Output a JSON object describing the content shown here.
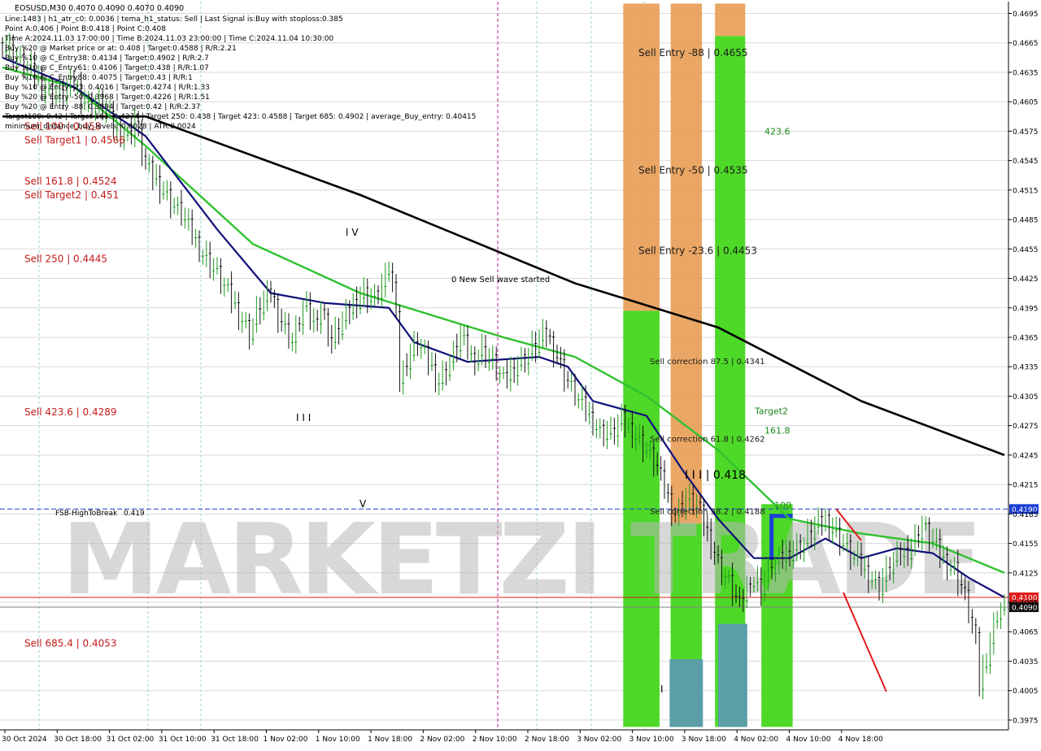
{
  "header": {
    "symbol_line": "EOSUSD,M30  0.4070 0.4090 0.4070 0.4090",
    "info_lines": [
      "Line:1483 | h1_atr_c0: 0.0036 | tema_h1_status: Sell | Last Signal is:Buy with stoploss:0.385",
      "Point A:0.406 | Point B:0.418 | Point C:0.408",
      "Time A:2024.11.03 17:00:00 | Time B:2024.11.03 23:00:00 | Time C:2024.11.04 10:30:00",
      "Buy %20 @ Market price or at: 0.408 | Target:0.4588 | R/R:2.21",
      "Buy %10 @ C_Entry38: 0.4134 | Target:0.4902 | R/R:2.7",
      "Buy %10 @ C_Entry61: 0.4106 | Target:0.438 | R/R:1.07",
      "Buy %10 @ C_Entry88: 0.4075 | Target:0.43 | R/R:1",
      "Buy %10 @ Entry -23: 0.4016 | Target:0.4274 | R/R:1.33",
      "Buy %20 @ Entry -50: 0.3968 | Target:0.4226 | R/R:1.51",
      "Buy %20 @ Entry -88: 0.3894 | Target:0.42 | R/R:2.37",
      "Target100: 0.42 | Target 161: 0.4274 | Target 250: 0.438 | Target 423: 0.4588 | Target 685: 0.4902 | average_Buy_entry: 0.40415",
      "minimum_distance_buy_levels: 0.0028 | ATR:0.0024"
    ]
  },
  "left_labels": [
    {
      "text": "Sell 100 | 0.458",
      "price": 0.458
    },
    {
      "text": "Sell Target1 | 0.4566",
      "price": 0.4566
    },
    {
      "text": "Sell 161.8 | 0.4524",
      "price": 0.4524
    },
    {
      "text": "Sell Target2 | 0.451",
      "price": 0.451
    },
    {
      "text": "Sell  250 | 0.4445",
      "price": 0.4445
    },
    {
      "text": "Sell  423.6 | 0.4289",
      "price": 0.4289
    },
    {
      "text": "Sell  685.4 | 0.4053",
      "price": 0.4053
    }
  ],
  "zone_labels": [
    {
      "text": "Sell Entry -88 | 0.4655",
      "price": 0.4655
    },
    {
      "text": "Sell Entry -50 | 0.4535",
      "price": 0.4535
    },
    {
      "text": "Sell Entry -23.6 | 0.4453",
      "price": 0.4453
    },
    {
      "text": "Sell correction 87.5 | 0.4341",
      "price": 0.4341
    },
    {
      "text": "Sell correction 61.8 | 0.4262",
      "price": 0.4262
    },
    {
      "text": "Sell correction 38.2 | 0.4188",
      "price": 0.4188
    }
  ],
  "green_labels": [
    {
      "text": "423.6",
      "price": 0.4575
    },
    {
      "text": "Target2",
      "price": 0.429
    },
    {
      "text": "161.8",
      "price": 0.427
    },
    {
      "text": "100",
      "price": 0.4194
    }
  ],
  "annotations": {
    "wave_text": "0 New Sell wave started",
    "wave_roman_iv": "I V",
    "wave_roman_iii": "I I I",
    "wave_roman_v": "V",
    "wave_roman_i": "I",
    "point_label": "I I I | 0.418",
    "fsb_label": "FSB-HighToBreak",
    "fsb_value": "0.419",
    "watermark": "MARKETZI TRADE"
  },
  "price_tags": [
    {
      "text": "0.4190",
      "price": 0.419,
      "color": "#1a3fd6"
    },
    {
      "text": "0.4100",
      "price": 0.41,
      "color": "#e01b1b"
    },
    {
      "text": "0.4090",
      "price": 0.409,
      "color": "#111111"
    }
  ],
  "colors": {
    "background": "#ffffff",
    "grid": "#d8d8d8",
    "sell_orange": "#e9a15c",
    "bright_green": "#45d61c",
    "teal": "#5c9ea8",
    "black_ma": "#000000",
    "green_ma": "#2fc22f",
    "navy_ma": "#10107a",
    "red_line": "#e01b1b",
    "blue_line": "#1a3fd6"
  },
  "chart_data": {
    "type": "candlestick",
    "symbol": "EOSUSD",
    "timeframe": "M30",
    "ylim": [
      0.3965,
      0.4707
    ],
    "y_ticks": [
      "0.4695",
      "0.4665",
      "0.4635",
      "0.4605",
      "0.4575",
      "0.4545",
      "0.4515",
      "0.4485",
      "0.4455",
      "0.4425",
      "0.4395",
      "0.4365",
      "0.4335",
      "0.4305",
      "0.4275",
      "0.4245",
      "0.4215",
      "0.4185",
      "0.4155",
      "0.4125",
      "0.4095",
      "0.4065",
      "0.4035",
      "0.4005",
      "0.3975"
    ],
    "x_ticks": [
      "30 Oct 2024",
      "30 Oct 18:00",
      "31 Oct 02:00",
      "31 Oct 10:00",
      "31 Oct 18:00",
      "1 Nov 02:00",
      "1 Nov 10:00",
      "1 Nov 18:00",
      "2 Nov 02:00",
      "2 Nov 10:00",
      "2 Nov 18:00",
      "3 Nov 02:00",
      "3 Nov 10:00",
      "3 Nov 18:00",
      "4 Nov 02:00",
      "4 Nov 10:00",
      "4 Nov 18:00"
    ],
    "close_path": [
      [
        0,
        0.4665
      ],
      [
        4,
        0.465
      ],
      [
        8,
        0.4635
      ],
      [
        12,
        0.462
      ],
      [
        16,
        0.461
      ],
      [
        20,
        0.4625
      ],
      [
        24,
        0.46
      ],
      [
        27,
        0.4605
      ],
      [
        31,
        0.458
      ],
      [
        35,
        0.457
      ],
      [
        37,
        0.4585
      ],
      [
        40,
        0.454
      ],
      [
        44,
        0.452
      ],
      [
        47,
        0.4505
      ],
      [
        50,
        0.449
      ],
      [
        53,
        0.447
      ],
      [
        56,
        0.445
      ],
      [
        60,
        0.443
      ],
      [
        63,
        0.441
      ],
      [
        66,
        0.439
      ],
      [
        69,
        0.437
      ],
      [
        72,
        0.4395
      ],
      [
        75,
        0.441
      ],
      [
        78,
        0.438
      ],
      [
        81,
        0.436
      ],
      [
        84,
        0.4395
      ],
      [
        87,
        0.438
      ],
      [
        89,
        0.4395
      ],
      [
        92,
        0.436
      ],
      [
        95,
        0.438
      ],
      [
        98,
        0.44
      ],
      [
        101,
        0.441
      ],
      [
        104,
        0.4405
      ],
      [
        107,
        0.442
      ],
      [
        108,
        0.4435
      ],
      [
        110,
        0.44
      ],
      [
        111,
        0.432
      ],
      [
        113,
        0.434
      ],
      [
        116,
        0.436
      ],
      [
        119,
        0.434
      ],
      [
        122,
        0.432
      ],
      [
        125,
        0.434
      ],
      [
        128,
        0.4365
      ],
      [
        131,
        0.4345
      ],
      [
        134,
        0.435
      ],
      [
        137,
        0.434
      ],
      [
        140,
        0.432
      ],
      [
        143,
        0.4335
      ],
      [
        146,
        0.4345
      ],
      [
        149,
        0.4355
      ],
      [
        152,
        0.437
      ],
      [
        155,
        0.4345
      ],
      [
        158,
        0.432
      ],
      [
        161,
        0.43
      ],
      [
        164,
        0.4285
      ],
      [
        167,
        0.427
      ],
      [
        170,
        0.4265
      ],
      [
        173,
        0.428
      ],
      [
        176,
        0.427
      ],
      [
        179,
        0.4255
      ],
      [
        182,
        0.424
      ],
      [
        185,
        0.421
      ],
      [
        188,
        0.4185
      ],
      [
        191,
        0.42
      ],
      [
        194,
        0.4195
      ],
      [
        197,
        0.4165
      ],
      [
        200,
        0.4135
      ],
      [
        203,
        0.4115
      ],
      [
        206,
        0.409
      ],
      [
        209,
        0.412
      ],
      [
        212,
        0.411
      ],
      [
        215,
        0.413
      ],
      [
        218,
        0.414
      ],
      [
        221,
        0.415
      ],
      [
        224,
        0.4155
      ],
      [
        227,
        0.417
      ],
      [
        230,
        0.418
      ],
      [
        233,
        0.4165
      ],
      [
        236,
        0.415
      ],
      [
        239,
        0.4135
      ],
      [
        242,
        0.4125
      ],
      [
        245,
        0.411
      ],
      [
        248,
        0.413
      ],
      [
        251,
        0.4145
      ],
      [
        254,
        0.415
      ],
      [
        257,
        0.4175
      ],
      [
        260,
        0.4155
      ],
      [
        263,
        0.414
      ],
      [
        266,
        0.413
      ],
      [
        269,
        0.41
      ],
      [
        272,
        0.4055
      ],
      [
        273,
        0.401
      ],
      [
        275,
        0.404
      ],
      [
        278,
        0.4085
      ],
      [
        280,
        0.409
      ]
    ],
    "series": [
      {
        "kind": "moving_average_black",
        "values": [
          [
            0,
            0.459
          ],
          [
            40,
            0.459
          ],
          [
            100,
            0.451
          ],
          [
            160,
            0.442
          ],
          [
            200,
            0.4375
          ],
          [
            240,
            0.43
          ],
          [
            280,
            0.4245
          ]
        ]
      },
      {
        "kind": "moving_average_green",
        "values": [
          [
            0,
            0.464
          ],
          [
            20,
            0.462
          ],
          [
            40,
            0.456
          ],
          [
            70,
            0.446
          ],
          [
            100,
            0.441
          ],
          [
            140,
            0.4365
          ],
          [
            160,
            0.4345
          ],
          [
            180,
            0.4305
          ],
          [
            200,
            0.425
          ],
          [
            220,
            0.418
          ],
          [
            240,
            0.4165
          ],
          [
            260,
            0.4155
          ],
          [
            280,
            0.4125
          ]
        ]
      },
      {
        "kind": "moving_average_navy",
        "values": [
          [
            0,
            0.465
          ],
          [
            20,
            0.462
          ],
          [
            40,
            0.457
          ],
          [
            60,
            0.4475
          ],
          [
            75,
            0.441
          ],
          [
            90,
            0.44
          ],
          [
            108,
            0.4395
          ],
          [
            115,
            0.436
          ],
          [
            130,
            0.434
          ],
          [
            150,
            0.4345
          ],
          [
            158,
            0.4335
          ],
          [
            165,
            0.43
          ],
          [
            180,
            0.4285
          ],
          [
            190,
            0.423
          ],
          [
            200,
            0.418
          ],
          [
            210,
            0.414
          ],
          [
            220,
            0.414
          ],
          [
            230,
            0.416
          ],
          [
            240,
            0.414
          ],
          [
            250,
            0.415
          ],
          [
            260,
            0.4145
          ],
          [
            270,
            0.412
          ],
          [
            280,
            0.41
          ]
        ]
      }
    ],
    "zones": [
      {
        "kind": "orange",
        "x_from": 0.618,
        "x_to": 0.654,
        "y_from": 0.4705,
        "y_to": 0.4392
      },
      {
        "kind": "green",
        "x_from": 0.618,
        "x_to": 0.654,
        "y_from": 0.4392,
        "y_to": 0.3968
      },
      {
        "kind": "orange",
        "x_from": 0.665,
        "x_to": 0.696,
        "y_from": 0.4705,
        "y_to": 0.4175
      },
      {
        "kind": "green",
        "x_from": 0.665,
        "x_to": 0.696,
        "y_from": 0.4175,
        "y_to": 0.3968
      },
      {
        "kind": "orange",
        "x_from": 0.709,
        "x_to": 0.739,
        "y_from": 0.4705,
        "y_to": 0.4672
      },
      {
        "kind": "green",
        "x_from": 0.709,
        "x_to": 0.739,
        "y_from": 0.4672,
        "y_to": 0.3968
      },
      {
        "kind": "green",
        "x_from": 0.755,
        "x_to": 0.786,
        "y_from": 0.4195,
        "y_to": 0.3968
      }
    ],
    "teal_blocks": [
      {
        "x_from": 0.664,
        "x_to": 0.697,
        "y_from": 0.4037,
        "y_to": 0.3968
      },
      {
        "x_from": 0.712,
        "x_to": 0.741,
        "y_from": 0.4073,
        "y_to": 0.3968
      }
    ]
  }
}
